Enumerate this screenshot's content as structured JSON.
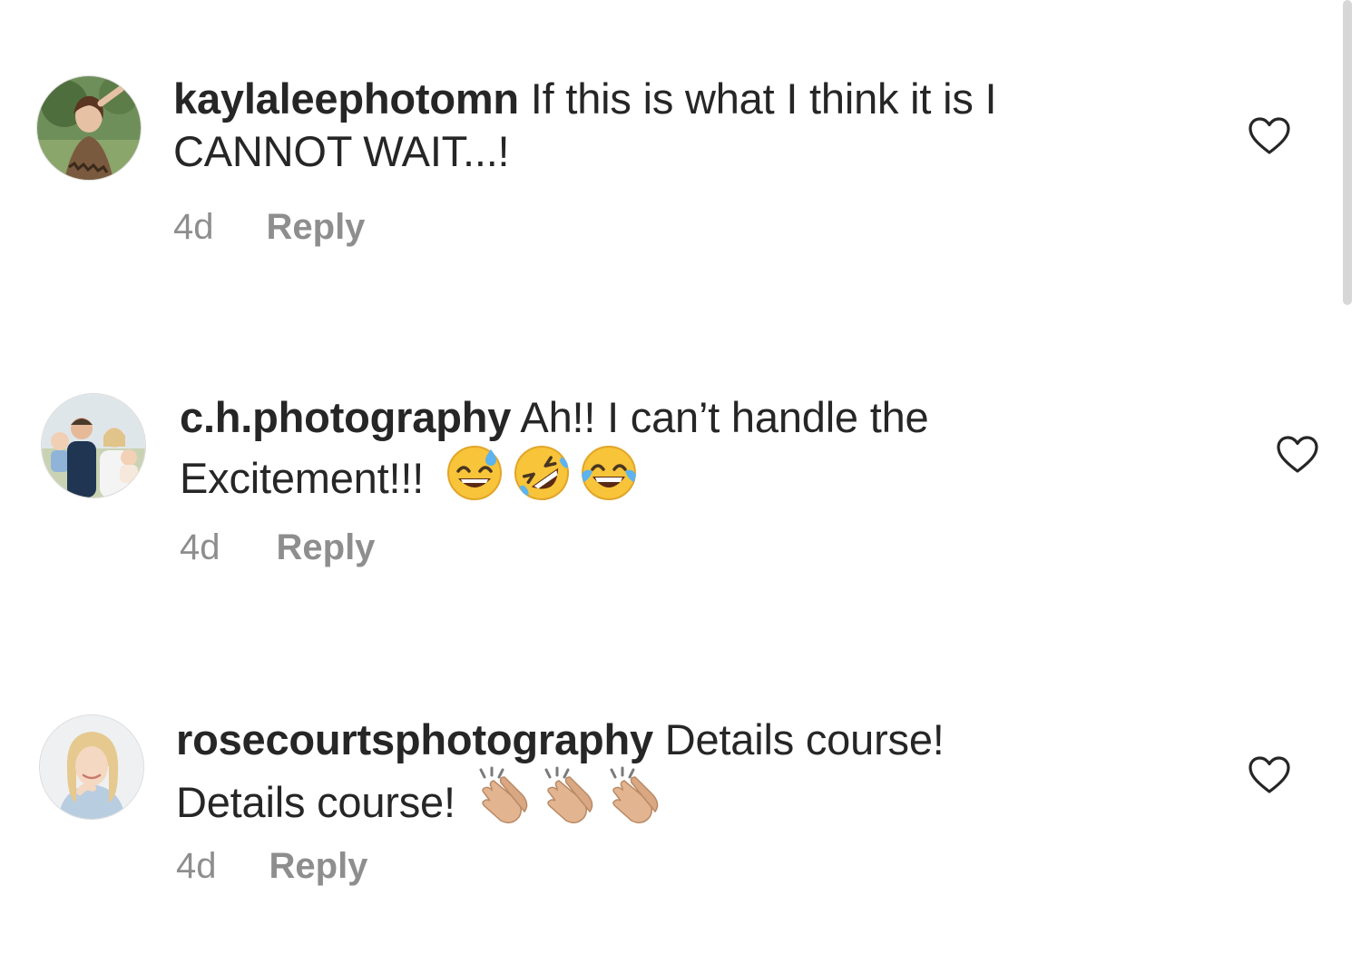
{
  "comments": [
    {
      "username": "kaylaleephotomn",
      "text_line1": " If this is what I think it is I",
      "text_line2": "CANNOT WAIT...!",
      "time": "4d",
      "reply": "Reply",
      "emojis": []
    },
    {
      "username": "c.h.photography",
      "text_line1": " Ah!! I can’t handle the",
      "text_line2": "Excitement!!!",
      "time": "4d",
      "reply": "Reply",
      "emojis": [
        "sweat-smile-emoji",
        "rofl-emoji",
        "tears-of-joy-emoji"
      ]
    },
    {
      "username": "rosecourtsphotography",
      "text_line1": " Details course!",
      "text_line2": "Details course!",
      "time": "4d",
      "reply": "Reply",
      "emojis": [
        "clapping-hands-emoji",
        "clapping-hands-emoji",
        "clapping-hands-emoji"
      ]
    }
  ],
  "colors": {
    "text": "#262626",
    "secondary": "#8e8e8e",
    "border": "#dbdbdb"
  }
}
